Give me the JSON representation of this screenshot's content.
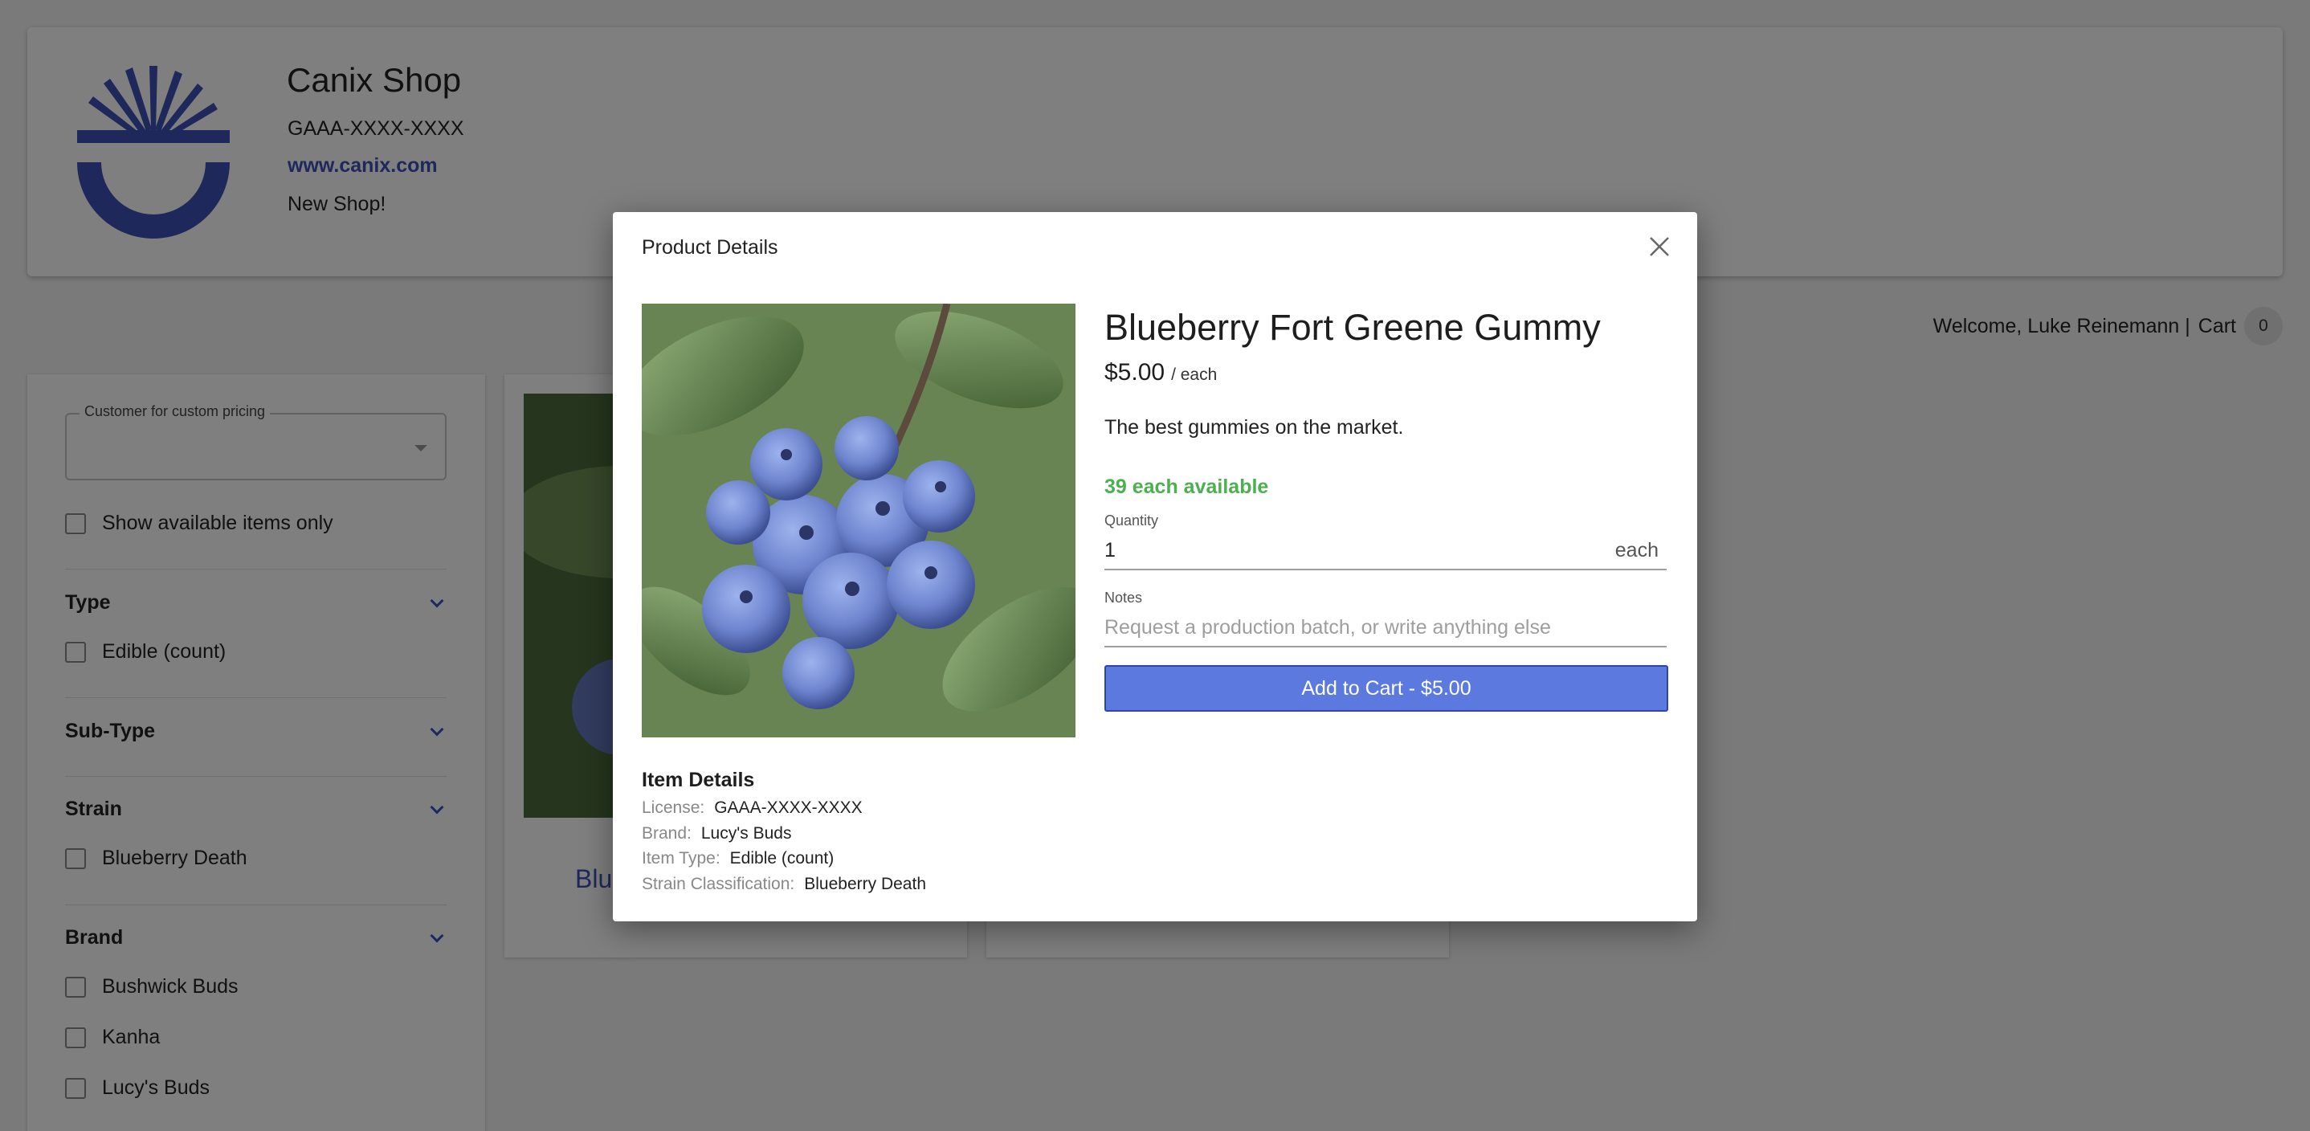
{
  "shop": {
    "name": "Canix Shop",
    "license": "GAAA-XXXX-XXXX",
    "url": "www.canix.com",
    "tagline": "New Shop!"
  },
  "user_bar": {
    "welcome": "Welcome, Luke Reinemann |",
    "cart_label": "Cart",
    "cart_count": "0"
  },
  "filters": {
    "custom_pricing_label": "Customer for custom pricing",
    "available_only_label": "Show available items only",
    "sections": [
      {
        "heading": "Type",
        "options": [
          "Edible (count)"
        ]
      },
      {
        "heading": "Sub-Type",
        "options": []
      },
      {
        "heading": "Strain",
        "options": [
          "Blueberry Death"
        ]
      },
      {
        "heading": "Brand",
        "options": [
          "Bushwick Buds",
          "Kanha",
          "Lucy's Buds"
        ]
      }
    ]
  },
  "cards": [
    {
      "title_visible": "Blu"
    }
  ],
  "modal": {
    "title": "Product Details",
    "product_name": "Blueberry Fort Greene Gummy",
    "price": "$5.00",
    "price_unit": "/ each",
    "description": "The best gummies on the market.",
    "availability": "39 each available",
    "quantity_label": "Quantity",
    "quantity_value": "1",
    "quantity_unit": "each",
    "notes_label": "Notes",
    "notes_placeholder": "Request a production batch, or write anything else",
    "add_button": "Add to Cart - $5.00",
    "details_heading": "Item Details",
    "details": [
      {
        "key": "License:",
        "value": "GAAA-XXXX-XXXX"
      },
      {
        "key": "Brand:",
        "value": "Lucy's Buds"
      },
      {
        "key": "Item Type:",
        "value": "Edible (count)"
      },
      {
        "key": "Strain Classification:",
        "value": "Blueberry Death"
      }
    ]
  },
  "colors": {
    "brand_blue": "#3f51b5",
    "button_blue": "#5c79e0",
    "available_green": "#4caf50"
  }
}
